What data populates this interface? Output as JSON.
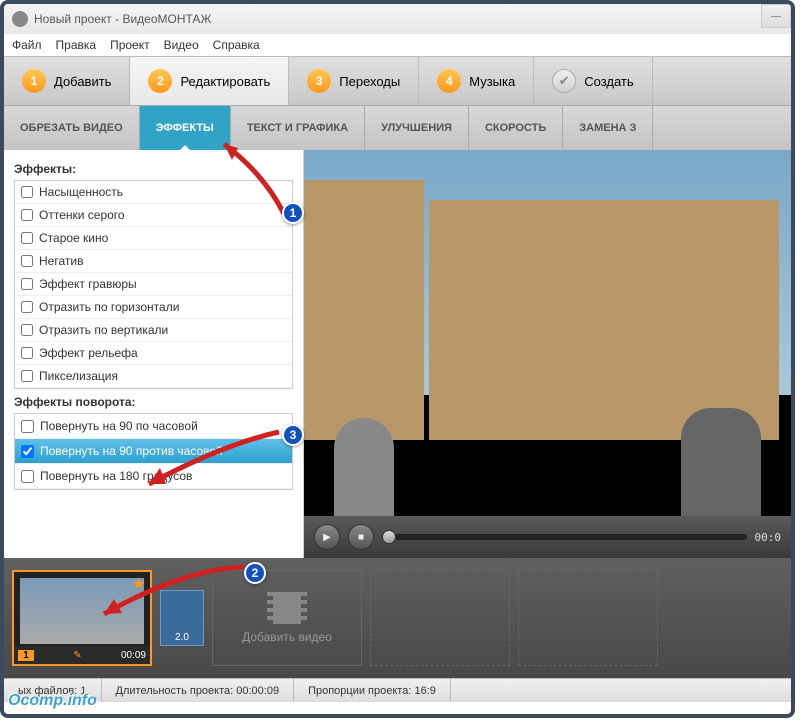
{
  "window": {
    "title": "Новый проект - ВидеоМОНТАЖ"
  },
  "menu": {
    "file": "Файл",
    "edit": "Правка",
    "project": "Проект",
    "video": "Видео",
    "help": "Справка"
  },
  "tabs": {
    "add": {
      "num": "1",
      "label": "Добавить"
    },
    "editTab": {
      "num": "2",
      "label": "Редактировать"
    },
    "transitions": {
      "num": "3",
      "label": "Переходы"
    },
    "music": {
      "num": "4",
      "label": "Музыка"
    },
    "create": {
      "label": "Создать"
    }
  },
  "subtabs": {
    "crop": "ОБРЕЗАТЬ ВИДЕО",
    "effects": "ЭФФЕКТЫ",
    "text": "ТЕКСТ И ГРАФИКА",
    "enhance": "УЛУЧШЕНИЯ",
    "speed": "СКОРОСТЬ",
    "replace": "ЗАМЕНА З"
  },
  "panel": {
    "effects_heading": "Эффекты:",
    "effects": [
      "Насыщенность",
      "Оттенки серого",
      "Старое кино",
      "Негатив",
      "Эффект гравюры",
      "Отразить по горизонтали",
      "Отразить по вертикали",
      "Эффект рельефа",
      "Пикселизация"
    ],
    "rotation_heading": "Эффекты поворота:",
    "rotations": [
      {
        "label": "Повернуть на 90 по часовой",
        "checked": false,
        "selected": false
      },
      {
        "label": "Повернуть на 90 против часовой",
        "checked": true,
        "selected": true
      },
      {
        "label": "Повернуть на 180 градусов",
        "checked": false,
        "selected": false
      }
    ]
  },
  "player": {
    "time": "00:0"
  },
  "timeline": {
    "clip": {
      "index": "1",
      "duration": "00:09"
    },
    "transition": {
      "duration": "2.0"
    },
    "add_label": "Добавить видео"
  },
  "status": {
    "files": "ых файлов: 1",
    "duration": "Длительность проекта:  00:00:09",
    "ratio": "Пропорции проекта:   16:9"
  },
  "badges": {
    "b1": "1",
    "b2": "2",
    "b3": "3"
  },
  "watermark": "Ocomp.info"
}
